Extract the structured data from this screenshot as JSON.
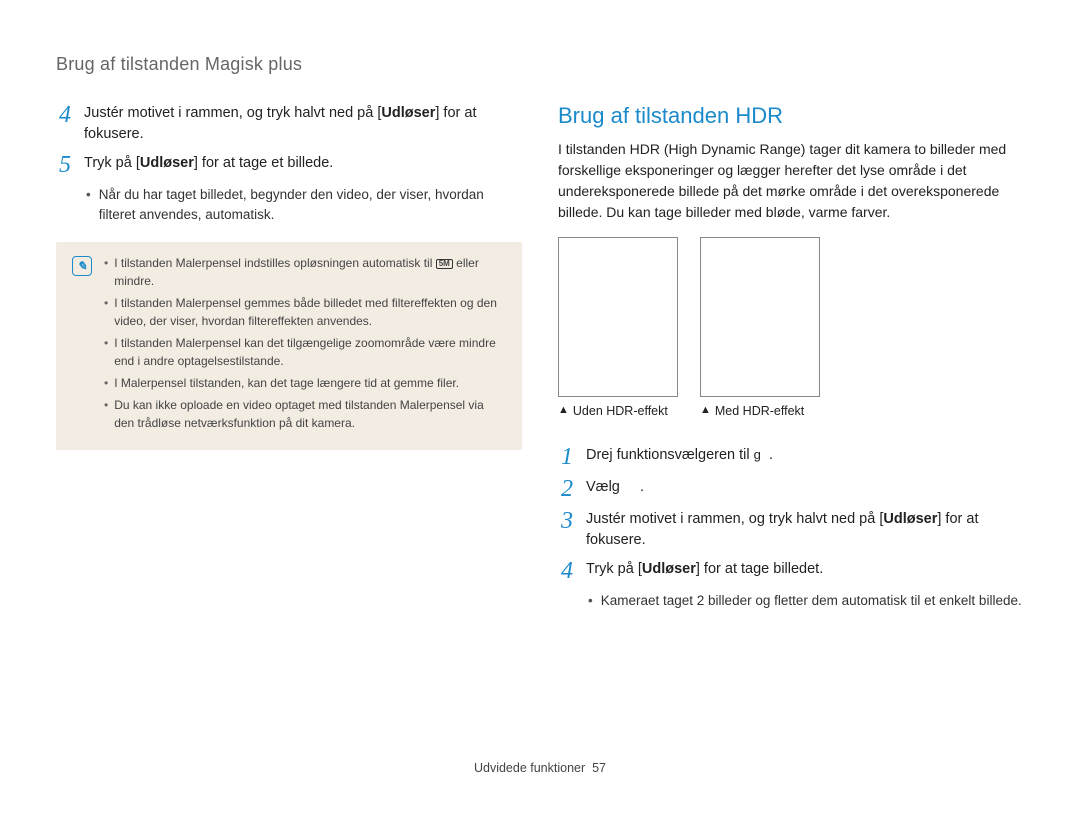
{
  "header": {
    "title": "Brug af tilstanden Magisk plus"
  },
  "left": {
    "step4": {
      "num": "4",
      "pre": "Justér motivet i rammen, og tryk halvt ned på [",
      "bold": "Udløser",
      "post": "] for at fokusere."
    },
    "step5": {
      "num": "5",
      "pre": "Tryk på [",
      "bold": "Udløser",
      "post": "] for at tage et billede."
    },
    "step5_sub": "Når du har taget billedet, begynder den video, der viser, hvordan filteret anvendes, automatisk.",
    "note_icon_aria": "note",
    "notes": [
      {
        "pre": "I tilstanden Malerpensel indstilles opløsningen automatisk til ",
        "icon": "5M",
        "post": " eller mindre."
      },
      {
        "text": "I tilstanden Malerpensel gemmes både billedet med filtereffekten og den video, der viser, hvordan filtereffekten anvendes."
      },
      {
        "text": "I tilstanden Malerpensel kan det tilgængelige zoomområde være mindre end i andre optagelsestilstande."
      },
      {
        "text": "I Malerpensel tilstanden, kan det tage længere tid at gemme filer."
      },
      {
        "text": "Du kan ikke oploade en video optaget med tilstanden Malerpensel via den trådløse netværksfunktion på dit kamera."
      }
    ]
  },
  "right": {
    "title": "Brug af tilstanden HDR",
    "intro": "I tilstanden HDR (High Dynamic Range) tager dit kamera to billeder med forskellige eksponeringer og lægger herefter det lyse område i det undereksponerede billede på det mørke område i det overeksponerede billede. Du kan tage billeder med bløde, varme farver.",
    "img1_caption": "Uden HDR-effekt",
    "img2_caption": "Med HDR-effekt",
    "step1": {
      "num": "1",
      "pre": "Drej funktionsvælgeren til ",
      "icon": "g",
      "post": "."
    },
    "step2": {
      "num": "2",
      "pre": "Vælg ",
      "post": "."
    },
    "step3": {
      "num": "3",
      "pre": "Justér motivet i rammen, og tryk halvt ned på [",
      "bold": "Udløser",
      "post": "] for at fokusere."
    },
    "step4": {
      "num": "4",
      "pre": "Tryk på [",
      "bold": "Udløser",
      "post": "] for at tage billedet."
    },
    "step4_sub": "Kameraet taget 2 billeder og fletter dem automatisk til et enkelt billede."
  },
  "footer": {
    "section": "Udvidede funktioner",
    "page": "57"
  }
}
